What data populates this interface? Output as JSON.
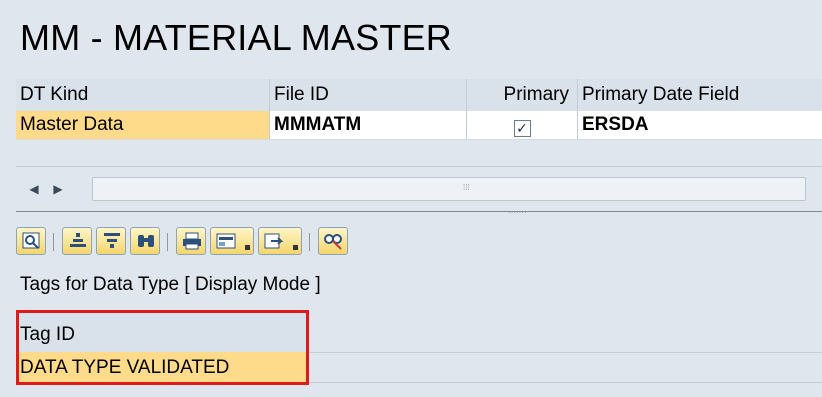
{
  "header": {
    "title": "MM - MATERIAL MASTER"
  },
  "datatypes_table": {
    "columns": [
      "DT Kind",
      "File ID",
      "Primary",
      "Primary Date Field"
    ],
    "rows": [
      {
        "dt_kind": "Master Data",
        "file_id": "MMMATM",
        "primary": "✓",
        "primary_date_field": "ERSDA"
      }
    ]
  },
  "toolbar": {
    "buttons": [
      "details-icon",
      "sort-ascending-icon",
      "filter-icon",
      "find-icon",
      "print-icon",
      "layout-icon",
      "export-icon",
      "glasses-icon"
    ]
  },
  "tags": {
    "label": "Tags for Data Type [ Display Mode ]",
    "columns": [
      "Tag ID"
    ],
    "rows": [
      {
        "tag_id": "DATA TYPE VALIDATED"
      }
    ]
  },
  "colors": {
    "selected_row": "#fddb8a",
    "highlight_border": "#e01a1a",
    "background": "#dfe6ee"
  }
}
